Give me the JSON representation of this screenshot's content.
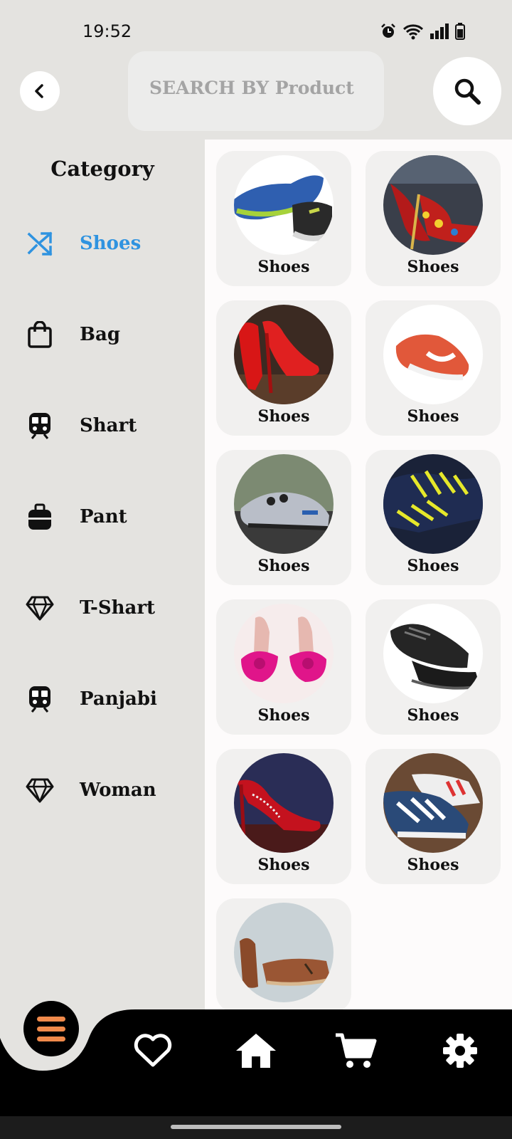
{
  "status_bar": {
    "time": "19:52"
  },
  "search": {
    "placeholder": "SEARCH BY Product"
  },
  "sidebar": {
    "title": "Category",
    "active_color": "#2f93e0",
    "items": [
      {
        "label": "Shoes",
        "icon": "shuffle-icon"
      },
      {
        "label": "Bag",
        "icon": "shopping-bag-icon"
      },
      {
        "label": "Shart",
        "icon": "train-icon"
      },
      {
        "label": "Pant",
        "icon": "luggage-icon"
      },
      {
        "label": "T-Shart",
        "icon": "diamond-icon"
      },
      {
        "label": "Panjabi",
        "icon": "train-icon"
      },
      {
        "label": "Woman",
        "icon": "diamond-icon"
      }
    ]
  },
  "products": [
    {
      "label": "Shoes"
    },
    {
      "label": "Shoes"
    },
    {
      "label": "Shoes"
    },
    {
      "label": "Shoes"
    },
    {
      "label": "Shoes"
    },
    {
      "label": "Shoes"
    },
    {
      "label": "Shoes"
    },
    {
      "label": "Shoes"
    },
    {
      "label": "Shoes"
    },
    {
      "label": "Shoes"
    },
    {
      "label": ""
    }
  ],
  "bottom_nav": {
    "accent": "#f08a4b",
    "icons": [
      "menu-icon",
      "heart-icon",
      "home-icon",
      "cart-icon",
      "settings-icon"
    ]
  }
}
